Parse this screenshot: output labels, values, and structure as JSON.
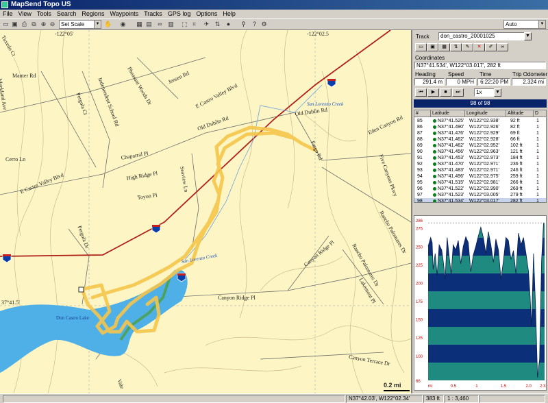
{
  "window": {
    "title": "MapSend Topo US"
  },
  "menu": [
    "File",
    "View",
    "Tools",
    "Search",
    "Regions",
    "Waypoints",
    "Tracks",
    "GPS log",
    "Options",
    "Help"
  ],
  "toolbar": {
    "scale_select": "Set Scale",
    "right_select": "Auto"
  },
  "map": {
    "coord_labels": {
      "top1": "-122°05'",
      "top2": "-122°02.5",
      "left": "37°41.5'"
    },
    "scale": "0.2 mi",
    "freeway_shields": [
      "580",
      "580",
      "580",
      "580"
    ],
    "road_labels": [
      "Tuxedo Ct",
      "Meekland Ave",
      "Manter Rd",
      "Pergola Ct",
      "Independent School Rd",
      "Pheasant Woods Dr",
      "Jensen Rd",
      "E Castro Valley Blvd",
      "Old Dublin Rd",
      "Cerro Ln",
      "E Castro Valley Blvd",
      "Chaparral Pl",
      "High Ridge Pl",
      "Toyon Pl",
      "Seaview Ln",
      "Pergola Dr",
      "Eden Canyon Rd",
      "Five Canyons Pkwy",
      "Rancho Palomares Dr",
      "Canyon Ridge Pl",
      "Rancho Palomares Dr",
      "Lakemont Pl",
      "Canyon Ridge Pl",
      "Canyon Terrace Dr",
      "Vale",
      "Fargo Rd",
      "Old Dublin Rd"
    ],
    "water_labels": [
      "San Lorenzo Creek",
      "San Lorenzo Creek",
      "Don Castro Lake"
    ]
  },
  "panel": {
    "track_label": "Track",
    "track_value": "don_castro_20001025",
    "coordinates_label": "Coordinates",
    "coordinates_value": "N37°41.534', W122°03.017', 282 ft",
    "heading_label": "Heading",
    "heading_value": "291.4 m",
    "speed_label": "Speed",
    "speed_value": "0 MPH",
    "time_label": "Time",
    "time_value": "6:22:20 PM",
    "odometer_label": "Trip Odometer",
    "odometer_value": "2.324 mi",
    "playback_speed": "1x",
    "point_counter": "98 of 98",
    "columns": [
      "#",
      "Latitude",
      "Longitude",
      "Altitude",
      "D"
    ],
    "rows": [
      {
        "n": "85",
        "lat": "N37°41.525'",
        "lon": "W122°02.938'",
        "alt": "92 ft",
        "d": "1"
      },
      {
        "n": "86",
        "lat": "N37°41.490'",
        "lon": "W122°02.926'",
        "alt": "82 ft",
        "d": "1"
      },
      {
        "n": "87",
        "lat": "N37°41.476'",
        "lon": "W122°02.929'",
        "alt": "69 ft",
        "d": "1"
      },
      {
        "n": "88",
        "lat": "N37°41.462'",
        "lon": "W122°02.928'",
        "alt": "66 ft",
        "d": "1"
      },
      {
        "n": "89",
        "lat": "N37°41.462'",
        "lon": "W122°02.952'",
        "alt": "102 ft",
        "d": "1"
      },
      {
        "n": "90",
        "lat": "N37°41.456'",
        "lon": "W122°02.963'",
        "alt": "121 ft",
        "d": "1"
      },
      {
        "n": "91",
        "lat": "N37°41.453'",
        "lon": "W122°02.973'",
        "alt": "184 ft",
        "d": "1"
      },
      {
        "n": "92",
        "lat": "N37°41.470'",
        "lon": "W122°02.971'",
        "alt": "236 ft",
        "d": "1"
      },
      {
        "n": "93",
        "lat": "N37°41.483'",
        "lon": "W122°02.971'",
        "alt": "246 ft",
        "d": "1"
      },
      {
        "n": "94",
        "lat": "N37°41.496'",
        "lon": "W122°02.975'",
        "alt": "259 ft",
        "d": "1"
      },
      {
        "n": "95",
        "lat": "N37°41.515'",
        "lon": "W122°02.981'",
        "alt": "266 ft",
        "d": "1"
      },
      {
        "n": "96",
        "lat": "N37°41.522'",
        "lon": "W122°02.990'",
        "alt": "269 ft",
        "d": "1"
      },
      {
        "n": "97",
        "lat": "N37°41.523'",
        "lon": "W122°03.005'",
        "alt": "279 ft",
        "d": "1"
      },
      {
        "n": "98",
        "lat": "N37°41.534'",
        "lon": "W122°03.017'",
        "alt": "282 ft",
        "d": "1"
      }
    ]
  },
  "chart_data": {
    "type": "area",
    "title": "",
    "yticks": [
      "286",
      "275",
      "250",
      "225",
      "200",
      "175",
      "150",
      "125",
      "100",
      "66"
    ],
    "xticks": [
      "mi",
      "0.5",
      "1",
      "1.5",
      "2.0",
      "2.32"
    ],
    "ylim": [
      66,
      286
    ],
    "xlim": [
      0,
      2.32
    ],
    "series": [
      {
        "x": [
          0,
          0.05,
          0.08,
          0.1,
          0.14,
          0.18,
          0.22,
          0.27,
          0.3,
          0.34,
          0.38,
          0.42,
          0.46,
          0.5,
          0.55,
          0.6,
          0.65,
          0.7,
          0.75,
          0.8,
          0.85,
          0.9,
          0.95,
          1.0,
          1.05,
          1.1,
          1.15,
          1.2,
          1.25,
          1.3,
          1.35,
          1.4,
          1.45,
          1.5,
          1.55,
          1.6,
          1.65,
          1.7,
          1.75,
          1.8,
          1.85,
          1.9,
          1.95,
          2.0,
          2.03,
          2.06,
          2.1,
          2.14,
          2.18,
          2.22,
          2.26,
          2.3,
          2.32
        ],
        "y": [
          250,
          262,
          255,
          218,
          240,
          210,
          252,
          245,
          230,
          205,
          262,
          235,
          212,
          252,
          245,
          258,
          226,
          250,
          263,
          255,
          215,
          238,
          250,
          264,
          276,
          262,
          240,
          270,
          252,
          228,
          260,
          245,
          205,
          230,
          262,
          258,
          232,
          244,
          212,
          268,
          252,
          262,
          240,
          215,
          182,
          140,
          240,
          168,
          70,
          95,
          230,
          282,
          282
        ]
      }
    ]
  },
  "status": {
    "coords": "N37°42.03', W122°02.34'",
    "alt": "383 ft",
    "scale": "1 : 3,460"
  },
  "colors": {
    "map_bg": "#fdf6c4",
    "freeway": "#b0201a",
    "track": "#f5c54a",
    "water": "#4fb0e8",
    "profile_teal": "#1f8a80",
    "profile_navy": "#0c2f7a"
  }
}
